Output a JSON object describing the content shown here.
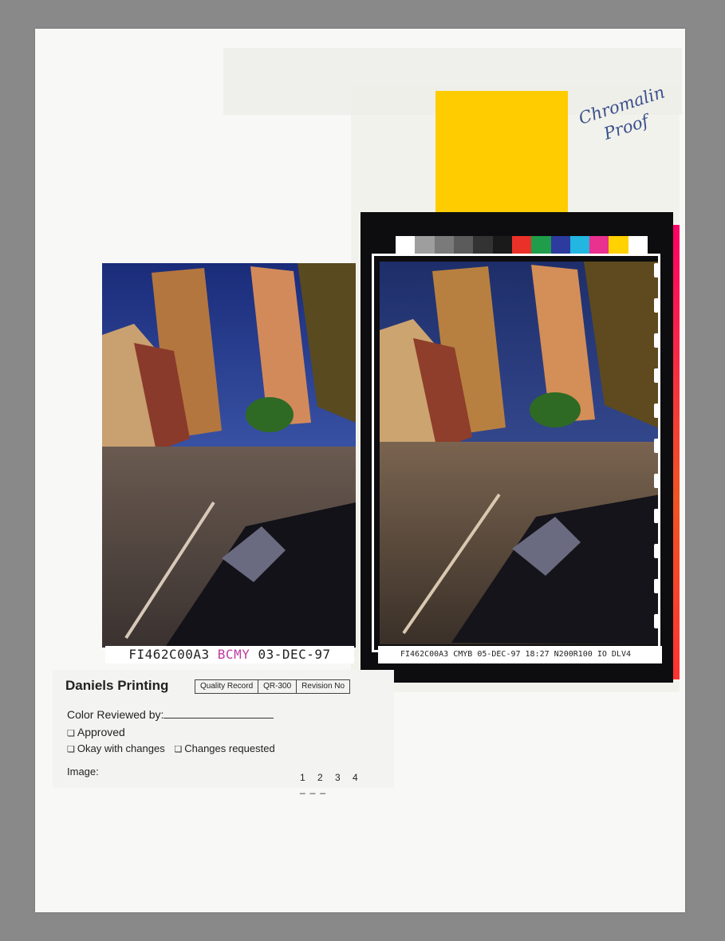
{
  "handwriting": {
    "line1": "Chromalin",
    "line2": "Proof"
  },
  "left_print": {
    "caption_code": "FI462C00A3",
    "caption_marks": "BCMY",
    "caption_date": "03-DEC-97"
  },
  "film": {
    "caption": "FI462C00A3 CMYB 05-DEC-97 18:27 N200R100 IO DLV4",
    "color_bar": [
      "#ffffff",
      "#9e9e9e",
      "#7a7a7a",
      "#5b5b5b",
      "#333333",
      "#1a1a1a",
      "#e9312a",
      "#1f9d4a",
      "#2d3b9e",
      "#22b6e0",
      "#e9318f",
      "#ffd200",
      "#ffffff"
    ]
  },
  "colors": {
    "yellow_patch": "#ffcc00",
    "accent": "#3a4f8c"
  },
  "quality_record": {
    "brand": "Daniels Printing",
    "header_cells": [
      "Quality Record",
      "QR-300",
      "Revision No"
    ],
    "reviewed_label": "Color Reviewed by:",
    "approved": "Approved",
    "okay_changes": "Okay with changes",
    "changes_requested": "Changes requested",
    "image_label": "Image:",
    "pages": "1 2 3 4 ___"
  }
}
